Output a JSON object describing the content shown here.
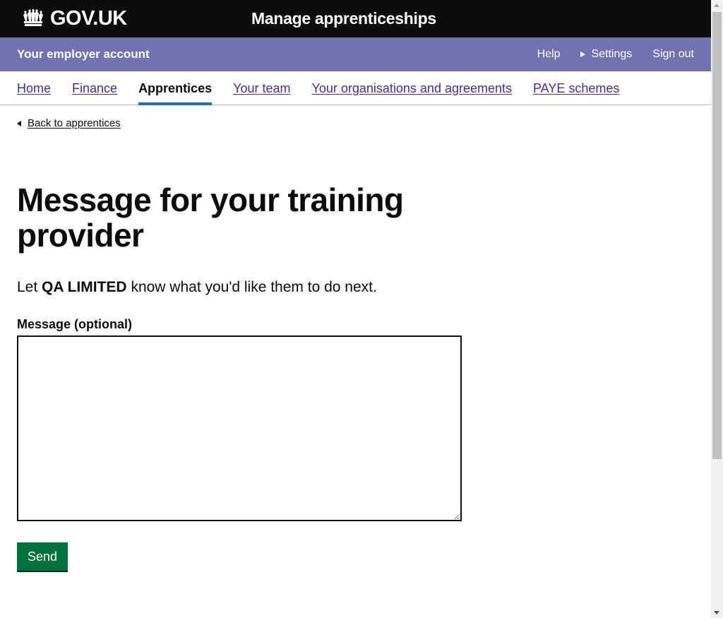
{
  "header": {
    "logo_text": "GOV.UK",
    "logo_icon": "crown-icon",
    "service_name": "Manage apprenticeships"
  },
  "account_bar": {
    "title": "Your employer account",
    "links": {
      "help": "Help",
      "settings": "Settings",
      "sign_out": "Sign out"
    },
    "background_color": "#7272b0"
  },
  "nav": {
    "items": [
      {
        "label": "Home",
        "active": false
      },
      {
        "label": "Finance",
        "active": false
      },
      {
        "label": "Apprentices",
        "active": true
      },
      {
        "label": "Your team",
        "active": false
      },
      {
        "label": "Your organisations and agreements",
        "active": false
      },
      {
        "label": "PAYE schemes",
        "active": false
      }
    ],
    "active_indicator_color": "#1d70b8"
  },
  "back_link": "Back to apprentices",
  "main": {
    "title": "Message for your training provider",
    "lead_prefix": "Let",
    "provider_name": "QA LIMITED",
    "lead_suffix": "know what you'd like them to do next.",
    "message_label": "Message (optional)",
    "message_value": "",
    "send_label": "Send",
    "send_color": "#00703c"
  }
}
